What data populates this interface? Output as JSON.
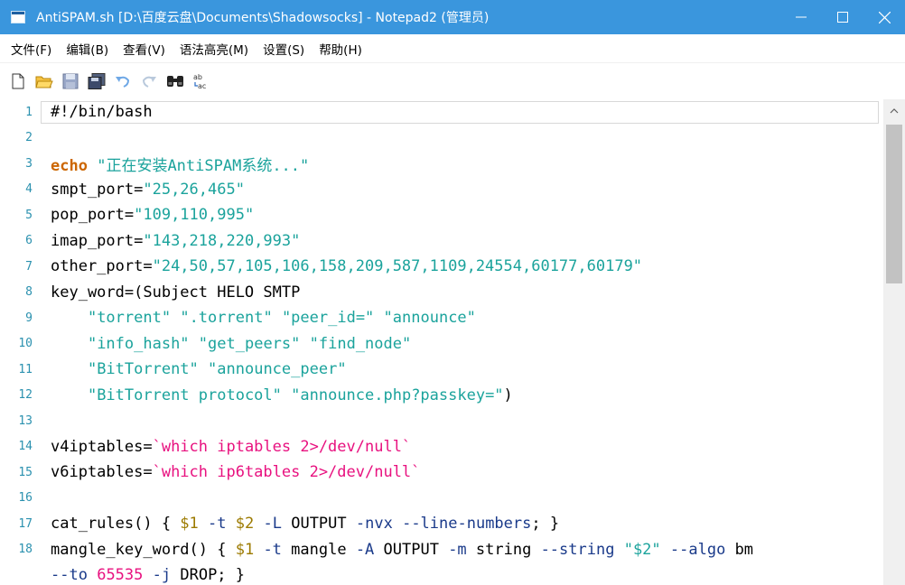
{
  "window": {
    "title": "AntiSPAM.sh [D:\\百度云盘\\Documents\\Shadowsocks] - Notepad2 (管理员)"
  },
  "menu": {
    "items": [
      "文件(F)",
      "编辑(B)",
      "查看(V)",
      "语法高亮(M)",
      "设置(S)",
      "帮助(H)"
    ]
  },
  "toolbar": {
    "icons": [
      "new-file-icon",
      "open-folder-icon",
      "save-icon",
      "save-all-icon",
      "undo-icon",
      "redo-icon",
      "find-icon",
      "replace-icon"
    ]
  },
  "editor": {
    "lines": [
      {
        "n": "1",
        "html": "#!/bin/bash"
      },
      {
        "n": "2",
        "html": ""
      },
      {
        "n": "3",
        "html": "<span class=\"kw\">echo</span> <span class=\"str\">\"正在安装AntiSPAM系统...\"</span>"
      },
      {
        "n": "4",
        "html": "smpt_port=<span class=\"str\">\"25,26,465\"</span>"
      },
      {
        "n": "5",
        "html": "pop_port=<span class=\"str\">\"109,110,995\"</span>"
      },
      {
        "n": "6",
        "html": "imap_port=<span class=\"str\">\"143,218,220,993\"</span>"
      },
      {
        "n": "7",
        "html": "other_port=<span class=\"str\">\"24,50,57,105,106,158,209,587,1109,24554,60177,60179\"</span>"
      },
      {
        "n": "8",
        "html": "key_word=(Subject HELO SMTP"
      },
      {
        "n": "9",
        "html": "    <span class=\"str\">\"torrent\"</span> <span class=\"str\">\".torrent\"</span> <span class=\"str\">\"peer_id=\"</span> <span class=\"str\">\"announce\"</span>"
      },
      {
        "n": "10",
        "html": "    <span class=\"str\">\"info_hash\"</span> <span class=\"str\">\"get_peers\"</span> <span class=\"str\">\"find_node\"</span>"
      },
      {
        "n": "11",
        "html": "    <span class=\"str\">\"BitTorrent\"</span> <span class=\"str\">\"announce_peer\"</span>"
      },
      {
        "n": "12",
        "html": "    <span class=\"str\">\"BitTorrent protocol\"</span> <span class=\"str\">\"announce.php?passkey=\"</span>)"
      },
      {
        "n": "13",
        "html": ""
      },
      {
        "n": "14",
        "html": "v4iptables=<span class=\"bt\">`which iptables 2>/dev/null`</span>"
      },
      {
        "n": "15",
        "html": "v6iptables=<span class=\"bt\">`which ip6tables 2>/dev/null`</span>"
      },
      {
        "n": "16",
        "html": ""
      },
      {
        "n": "17",
        "html": "cat_rules() { <span class=\"var\">$1</span> <span class=\"opt\">-t</span> <span class=\"var\">$2</span> <span class=\"opt\">-L</span> OUTPUT <span class=\"opt\">-nvx</span> <span class=\"opt\">--line-numbers</span>; }"
      },
      {
        "n": "18",
        "html": "mangle_key_word() { <span class=\"var\">$1</span> <span class=\"opt\">-t</span> mangle <span class=\"opt\">-A</span> OUTPUT <span class=\"opt\">-m</span> string <span class=\"opt\">--string</span> <span class=\"str\">\"$2\"</span> <span class=\"opt\">--algo</span> bm"
      },
      {
        "n": "",
        "html": "<span class=\"opt\">--to</span> <span class=\"num\">65535</span> <span class=\"opt\">-j</span> DROP; }"
      }
    ]
  },
  "colors": {
    "titlebar": "#3a96dd",
    "line_number": "#2b91af",
    "string": "#1ba39c",
    "keyword": "#cc6600",
    "backtick": "#e8117f",
    "variable": "#9c7a00"
  }
}
